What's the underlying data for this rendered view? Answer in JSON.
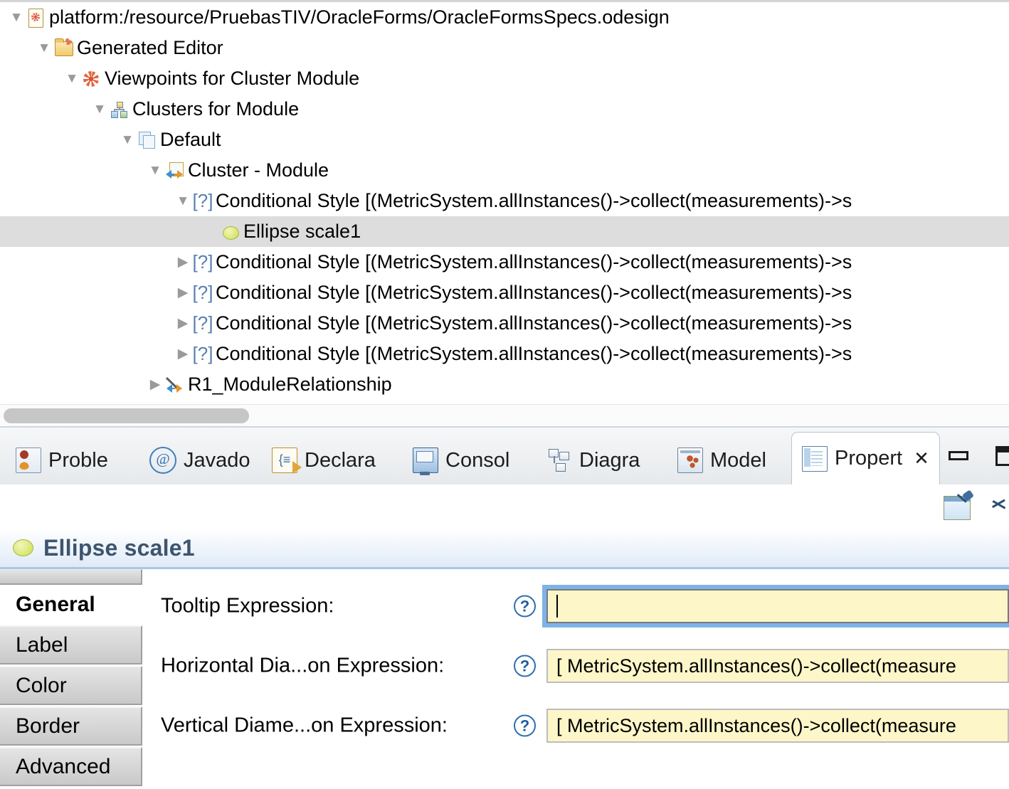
{
  "tree": {
    "rows": [
      {
        "indent": 0,
        "twisty": "▼",
        "icon": "odesign-file-icon",
        "label": "platform:/resource/PruebasTIV/OracleForms/OracleFormsSpecs.odesign",
        "selected": false
      },
      {
        "indent": 1,
        "twisty": "▼",
        "icon": "folder-icon",
        "label": "Generated Editor",
        "selected": false
      },
      {
        "indent": 2,
        "twisty": "▼",
        "icon": "viewpoint-icon",
        "label": "Viewpoints for Cluster Module",
        "selected": false
      },
      {
        "indent": 3,
        "twisty": "▼",
        "icon": "cluster-diagram-icon",
        "label": "Clusters for Module",
        "selected": false
      },
      {
        "indent": 4,
        "twisty": "▼",
        "icon": "default-layer-icon",
        "label": "Default",
        "selected": false
      },
      {
        "indent": 5,
        "twisty": "▼",
        "icon": "module-node-icon",
        "label": "Cluster - Module",
        "selected": false
      },
      {
        "indent": 6,
        "twisty": "▼",
        "icon": "conditional-style-icon",
        "label": "Conditional Style [(MetricSystem.allInstances()->collect(measurements)->s",
        "selected": false
      },
      {
        "indent": 7,
        "twisty": "",
        "icon": "ellipse-icon",
        "label": "Ellipse scale1",
        "selected": true
      },
      {
        "indent": 6,
        "twisty": "▶",
        "icon": "conditional-style-icon",
        "label": "Conditional Style [(MetricSystem.allInstances()->collect(measurements)->s",
        "selected": false
      },
      {
        "indent": 6,
        "twisty": "▶",
        "icon": "conditional-style-icon",
        "label": "Conditional Style [(MetricSystem.allInstances()->collect(measurements)->s",
        "selected": false
      },
      {
        "indent": 6,
        "twisty": "▶",
        "icon": "conditional-style-icon",
        "label": "Conditional Style [(MetricSystem.allInstances()->collect(measurements)->s",
        "selected": false
      },
      {
        "indent": 6,
        "twisty": "▶",
        "icon": "conditional-style-icon",
        "label": "Conditional Style [(MetricSystem.allInstances()->collect(measurements)->s",
        "selected": false
      },
      {
        "indent": 5,
        "twisty": "▶",
        "icon": "relationship-icon",
        "label": "R1_ModuleRelationship",
        "selected": false
      }
    ],
    "scrollbar": {
      "name": "horizontal-scrollbar"
    }
  },
  "tabbar": {
    "tabs": [
      {
        "label": "Proble",
        "icon": "problems-icon",
        "active": false,
        "closable": false
      },
      {
        "label": "Javado",
        "icon": "javadoc-icon",
        "active": false,
        "closable": false
      },
      {
        "label": "Declara",
        "icon": "declaration-icon",
        "active": false,
        "closable": false
      },
      {
        "label": "Consol",
        "icon": "console-icon",
        "active": false,
        "closable": false
      },
      {
        "label": "Diagra",
        "icon": "diagram-icon",
        "active": false,
        "closable": false
      },
      {
        "label": "Model",
        "icon": "model-icon",
        "active": false,
        "closable": false
      },
      {
        "label": "Propert",
        "icon": "properties-icon",
        "active": true,
        "closable": true
      }
    ],
    "close_glyph": "✕",
    "buttons": [
      {
        "name": "minimize-view-button",
        "icon": "minimize-icon"
      },
      {
        "name": "maximize-view-button",
        "icon": "maximize-icon"
      }
    ]
  },
  "view_toolbar": {
    "pin": "pin-to-selection-icon",
    "menu": "view-menu-chevron-icon"
  },
  "properties": {
    "title": "Ellipse scale1",
    "title_icon": "ellipse-icon",
    "tabs": [
      {
        "label": "General",
        "selected": true
      },
      {
        "label": "Label",
        "selected": false
      },
      {
        "label": "Color",
        "selected": false
      },
      {
        "label": "Border",
        "selected": false
      },
      {
        "label": "Advanced",
        "selected": false
      }
    ],
    "fields": [
      {
        "label": "Tooltip Expression:",
        "help": "?",
        "value": "",
        "focused": true
      },
      {
        "label": "Horizontal Dia...on Expression:",
        "help": "?",
        "value": "[ MetricSystem.allInstances()->collect(measure",
        "focused": false
      },
      {
        "label": "Vertical Diame...on Expression:",
        "help": "?",
        "value": "[ MetricSystem.allInstances()->collect(measure",
        "focused": false
      }
    ]
  },
  "colors": {
    "selection_row": "#dddddd",
    "input_background": "#fdf6c8",
    "focus_ring": "#7fb2e8",
    "title_text": "#3d556e",
    "conditional_icon": "#5a7fb0",
    "ellipse_fill": "#ddea7e"
  }
}
